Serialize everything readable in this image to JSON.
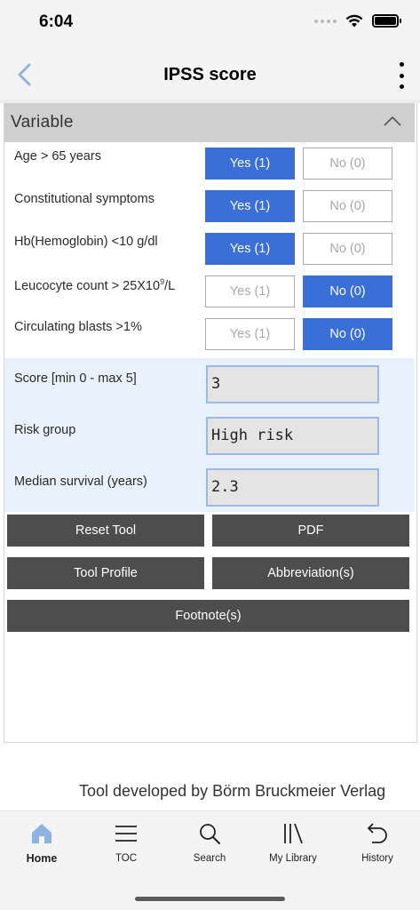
{
  "status_bar": {
    "time": "6:04"
  },
  "nav": {
    "title": "IPSS score"
  },
  "section": {
    "title": "Variable"
  },
  "variables": [
    {
      "label": "Age > 65 years",
      "yes": "Yes (1)",
      "no": "No (0)",
      "selected": "yes"
    },
    {
      "label": "Constitutional symptoms",
      "yes": "Yes (1)",
      "no": "No (0)",
      "selected": "yes"
    },
    {
      "label": "Hb(Hemoglobin) <10 g/dl",
      "yes": "Yes (1)",
      "no": "No (0)",
      "selected": "yes"
    },
    {
      "label_pre": "Leucocyte count > 25X10",
      "label_sup": "9",
      "label_post": "/L",
      "yes": "Yes (1)",
      "no": "No (0)",
      "selected": "no"
    },
    {
      "label": "Circulating blasts >1%",
      "yes": "Yes (1)",
      "no": "No (0)",
      "selected": "no"
    }
  ],
  "results": [
    {
      "label": "Score [min 0 - max 5]",
      "value": "3"
    },
    {
      "label": "Risk group",
      "value": "High risk"
    },
    {
      "label": "Median survival (years)",
      "value": "2.3"
    }
  ],
  "actions": {
    "reset": "Reset Tool",
    "pdf": "PDF",
    "profile": "Tool Profile",
    "abbreviations": "Abbreviation(s)",
    "footnotes": "Footnote(s)"
  },
  "credit": "Tool developed by Börm Bruckmeier Verlag",
  "tabs": [
    {
      "label": "Home",
      "icon": "home-icon",
      "active": true
    },
    {
      "label": "TOC",
      "icon": "list-icon",
      "active": false
    },
    {
      "label": "Search",
      "icon": "search-icon",
      "active": false
    },
    {
      "label": "My Library",
      "icon": "library-icon",
      "active": false
    },
    {
      "label": "History",
      "icon": "history-icon",
      "active": false
    }
  ],
  "colors": {
    "accent": "#3a6fd8",
    "action_button": "#4d4d4d",
    "header_gray": "#cfcfcf",
    "results_bg": "#e8f1fc",
    "home_icon": "#8fb3e0"
  }
}
